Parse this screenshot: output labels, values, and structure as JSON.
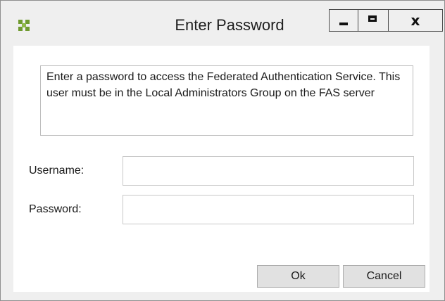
{
  "window": {
    "title": "Enter Password",
    "app_icon": "fas-app-icon",
    "controls": {
      "minimize_icon": "minimize-icon",
      "maximize_icon": "maximize-icon",
      "close_label": "x"
    }
  },
  "info": {
    "text": "Enter a password to access the Federated Authentication Service.  This user must be in the Local Administrators Group on the FAS server"
  },
  "form": {
    "username_label": "Username:",
    "username_value": "",
    "password_label": "Password:",
    "password_value": ""
  },
  "buttons": {
    "ok_label": "Ok",
    "cancel_label": "Cancel"
  },
  "colors": {
    "chrome": "#efefef",
    "client": "#ffffff",
    "icon_green": "#6f9a2f"
  }
}
